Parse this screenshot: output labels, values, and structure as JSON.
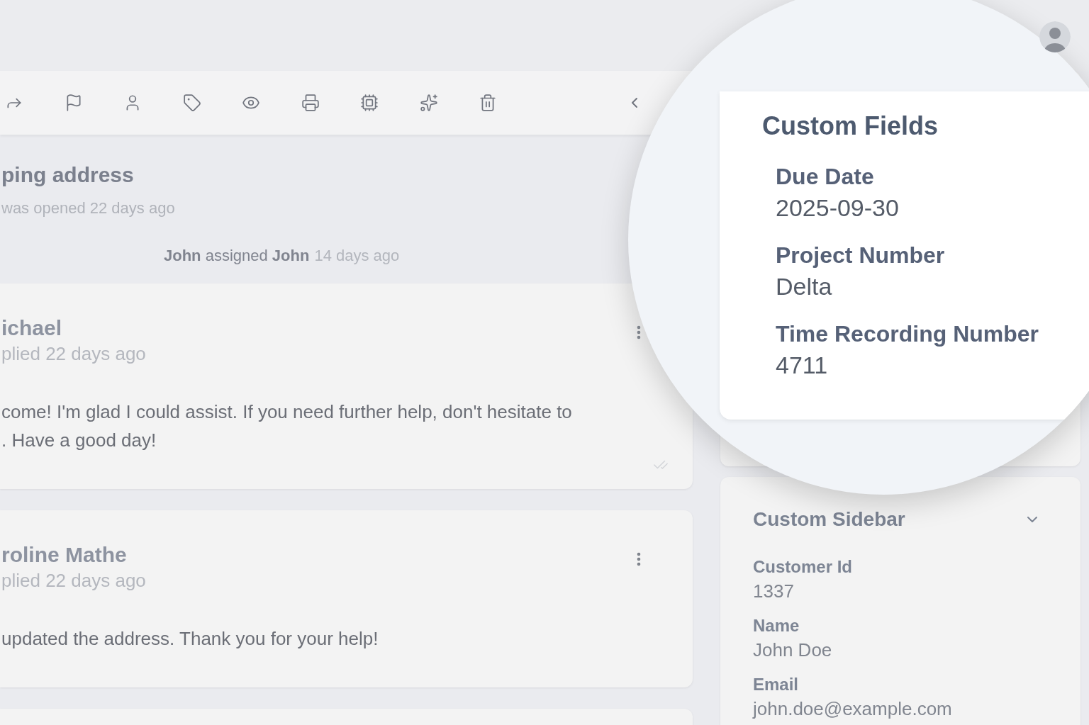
{
  "ticket": {
    "title": "ping address",
    "opened": "was opened 22 days ago"
  },
  "activity": {
    "text": "**John** assigned **John**",
    "time": "14 days ago"
  },
  "messages": [
    {
      "author": "ichael",
      "meta": "plied 22 days ago",
      "body": [
        "come! I'm glad I could assist. If you need further help, don't hesitate to",
        ". Have a good day!"
      ],
      "read": true
    },
    {
      "author": "roline Mathe",
      "meta": "plied 22 days ago",
      "body": [
        "updated the address. Thank you for your help!"
      ],
      "read": false
    }
  ],
  "sidebar": {
    "title": "Custom Sidebar",
    "expanded": true,
    "fields": [
      {
        "label": "Customer Id",
        "value": "1337"
      },
      {
        "label": "Name",
        "value": "John Doe"
      },
      {
        "label": "Email",
        "value": "john.doe@example.com"
      }
    ]
  },
  "magnifier": {
    "title": "Custom Fields",
    "fields": [
      {
        "label": "Due Date",
        "value": "2025-09-30"
      },
      {
        "label": "Project Number",
        "value": "Delta"
      },
      {
        "label": "Time Recording Number",
        "value": "4711"
      }
    ]
  }
}
